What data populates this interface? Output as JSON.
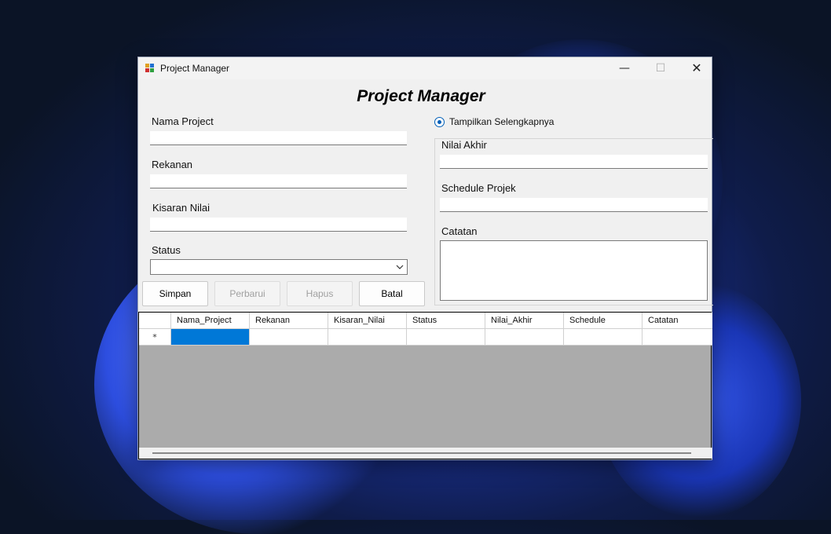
{
  "window": {
    "title": "Project Manager",
    "minimize_glyph": "—",
    "maximize_glyph": "☐",
    "close_glyph": "✕"
  },
  "form": {
    "heading": "Project Manager",
    "nama_project_label": "Nama Project",
    "rekanan_label": "Rekanan",
    "kisaran_nilai_label": "Kisaran Nilai",
    "status_label": "Status",
    "nama_project_value": "",
    "rekanan_value": "",
    "kisaran_nilai_value": "",
    "status_value": ""
  },
  "buttons": {
    "simpan": "Simpan",
    "perbarui": "Perbarui",
    "hapus": "Hapus",
    "batal": "Batal"
  },
  "details": {
    "radio_label": "Tampilkan Selengkapnya",
    "nilai_akhir_label": "Nilai Akhir",
    "schedule_label": "Schedule Projek",
    "catatan_label": "Catatan"
  },
  "grid": {
    "columns": [
      "Nama_Project",
      "Rekanan",
      "Kisaran_Nilai",
      "Status",
      "Nilai_Akhir",
      "Schedule",
      "Catatan"
    ],
    "new_row_marker": "*"
  },
  "colors": {
    "accent": "#0078d7",
    "grid_background": "#ababab"
  }
}
